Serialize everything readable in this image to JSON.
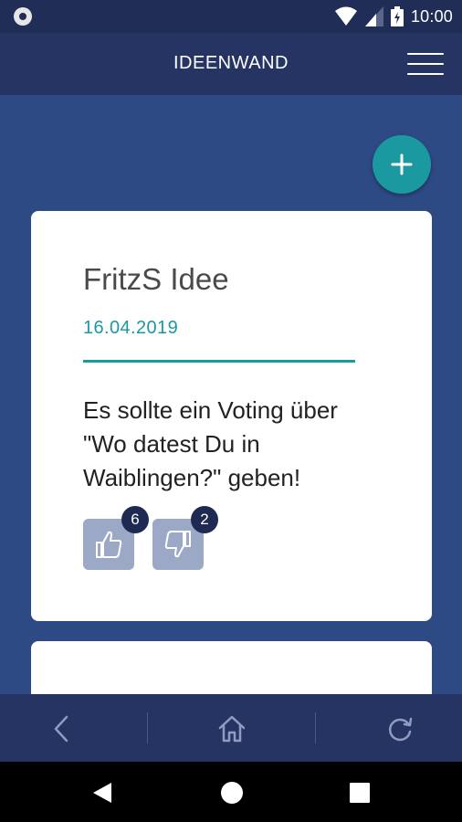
{
  "status_bar": {
    "time": "10:00",
    "icons": [
      "notification-circle-icon",
      "wifi-icon",
      "signal-icon",
      "battery-icon"
    ]
  },
  "app_bar": {
    "title": "IDEENWAND",
    "menu_icon": "hamburger-menu-icon"
  },
  "fab": {
    "icon": "plus-icon",
    "color": "#1a9aa0"
  },
  "ideas": [
    {
      "title": "FritzS Idee",
      "date": "16.04.2019",
      "text": "Es sollte ein Voting über \"Wo datest Du in Waiblingen?\" geben!",
      "likes": "6",
      "dislikes": "2"
    }
  ],
  "bottom_nav": {
    "items": [
      "back-icon",
      "home-icon",
      "refresh-icon"
    ]
  },
  "system_nav": {
    "items": [
      "back-triangle-icon",
      "home-circle-icon",
      "recents-square-icon"
    ]
  },
  "colors": {
    "background": "#2e4a85",
    "app_bar": "#263463",
    "accent": "#1a9aa0",
    "vote_button": "#9ba9c7",
    "badge": "#1e2a52"
  }
}
